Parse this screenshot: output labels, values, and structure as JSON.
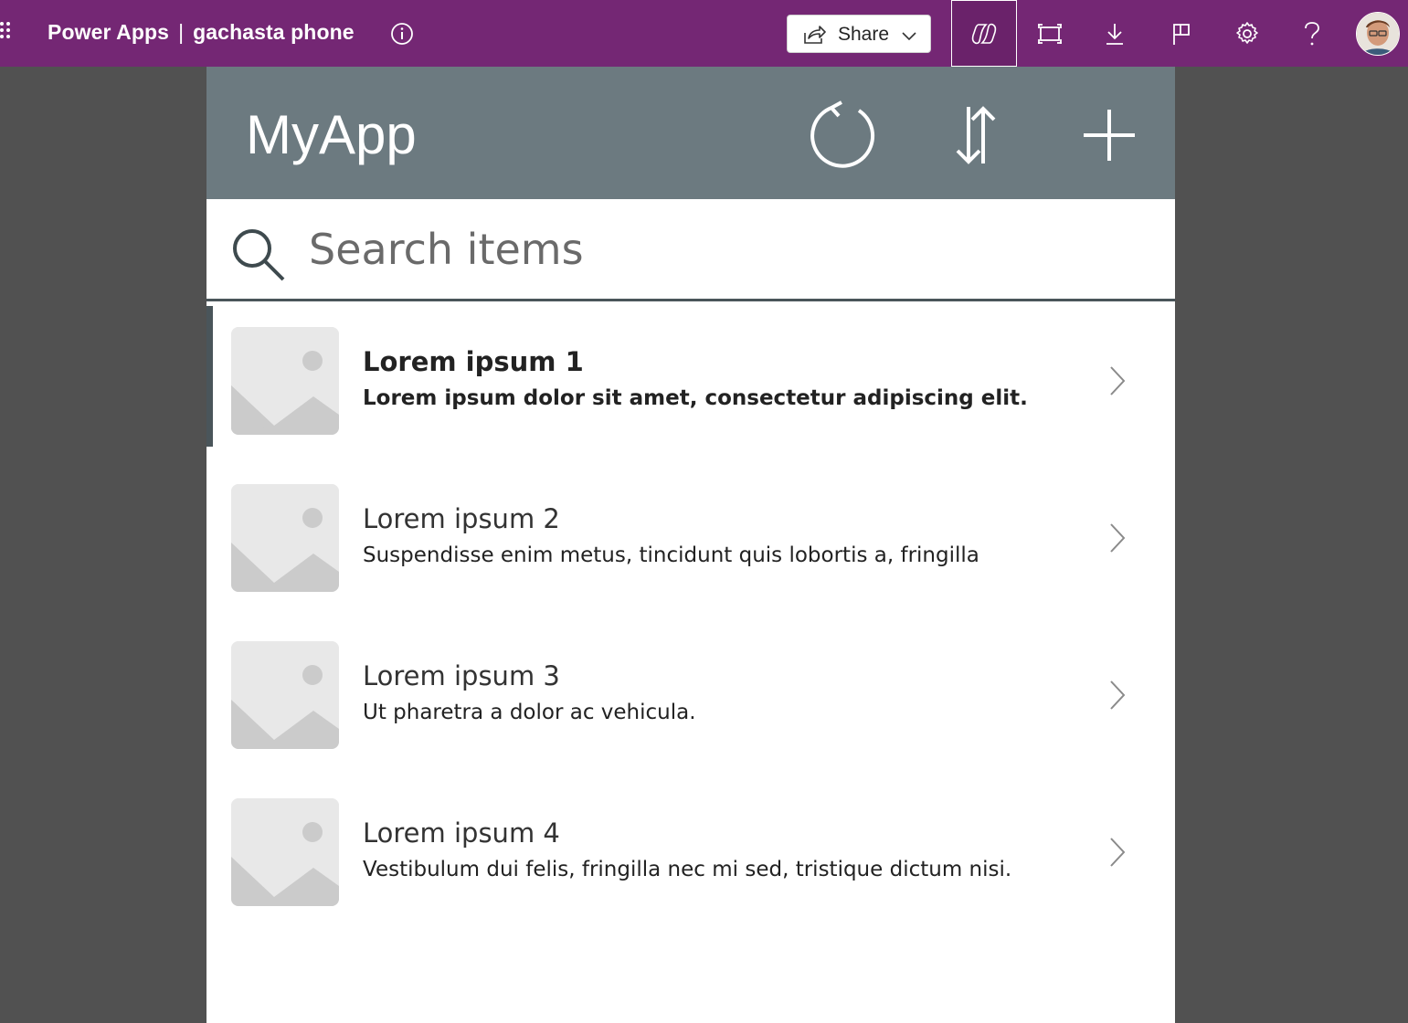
{
  "topbar": {
    "product": "Power Apps",
    "separator": "|",
    "app_name": "gachasta phone",
    "share_label": "Share",
    "icons": [
      "waffle-icon",
      "info-icon",
      "share-icon",
      "copilot-icon",
      "fit-to-window-icon",
      "download-icon",
      "flag-icon",
      "gear-icon",
      "help-icon",
      "avatar"
    ],
    "accent": "#742774"
  },
  "app": {
    "title": "MyApp",
    "header_color": "#6c7a80",
    "header_icons": [
      "refresh-icon",
      "sort-icon",
      "add-icon"
    ],
    "search": {
      "placeholder": "Search items",
      "value": ""
    },
    "items": [
      {
        "title": "Lorem ipsum 1",
        "subtitle": "Lorem ipsum dolor sit amet, consectetur adipiscing elit.",
        "selected": true
      },
      {
        "title": "Lorem ipsum 2",
        "subtitle": "Suspendisse enim metus, tincidunt quis lobortis a, fringilla",
        "selected": false
      },
      {
        "title": "Lorem ipsum 3",
        "subtitle": "Ut pharetra a dolor ac vehicula.",
        "selected": false
      },
      {
        "title": "Lorem ipsum 4",
        "subtitle": "Vestibulum dui felis, fringilla nec mi sed, tristique dictum nisi.",
        "selected": false
      }
    ]
  }
}
